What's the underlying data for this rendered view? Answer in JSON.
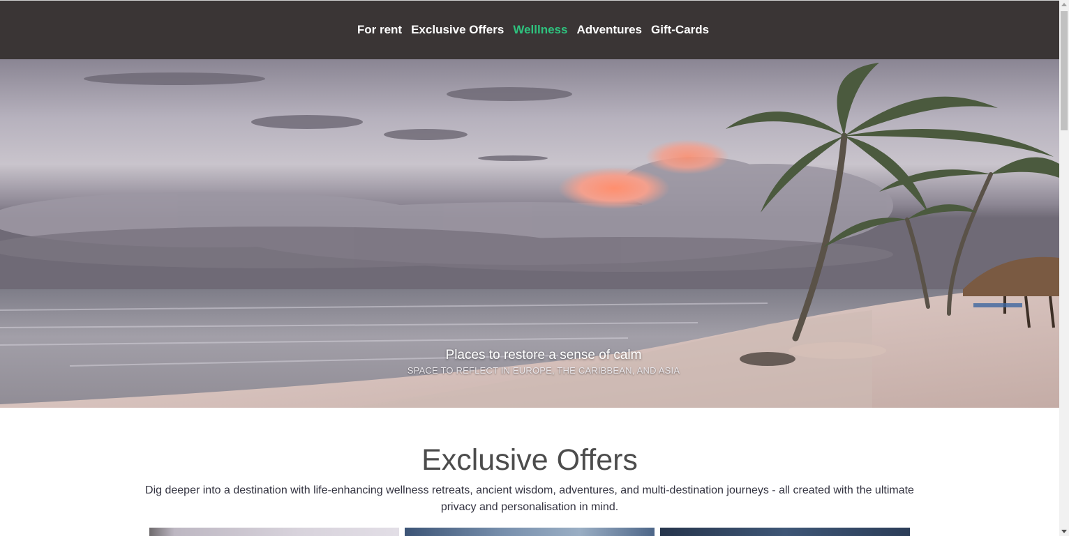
{
  "nav": {
    "items": [
      {
        "label": "For rent",
        "active": false
      },
      {
        "label": "Exclusive Offers",
        "active": false
      },
      {
        "label": "Welllness",
        "active": true
      },
      {
        "label": "Adventures",
        "active": false
      },
      {
        "label": "Gift-Cards",
        "active": false
      }
    ],
    "active_color": "#2ec27e",
    "background": "#3a3535"
  },
  "hero": {
    "title": "Places to restore a sense of calm",
    "subtitle": "SPACE TO REFLECT IN EUROPE, THE CARIBBEAN, AND ASIA"
  },
  "offers": {
    "title": "Exclusive Offers",
    "description": "Dig deeper into a destination with life-enhancing wellness retreats, ancient wisdom, adventures, and multi-destination journeys - all created with the ultimate privacy and personalisation in mind."
  }
}
